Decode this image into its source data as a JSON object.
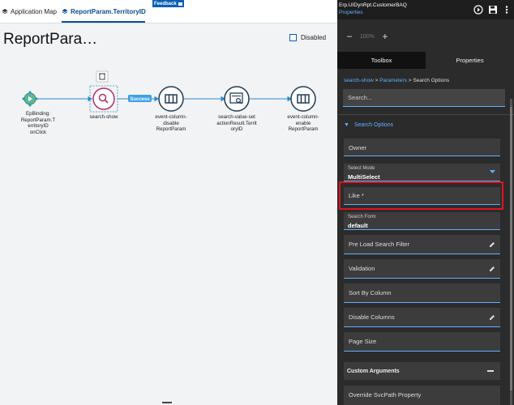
{
  "tabs": [
    {
      "label": "Application Map"
    },
    {
      "label": "ReportParam.TerritoryID"
    }
  ],
  "feedback_label": "Feedback",
  "flow_title": "ReportPara…",
  "disabled_label": "Disabled",
  "nodes": [
    {
      "label_lines": [
        "EpBinding:",
        "ReportParam.T",
        "erritoryID",
        "onClick"
      ]
    },
    {
      "label_lines": [
        "search-show"
      ]
    },
    {
      "label_lines": [
        "event-column-",
        "disable",
        "ReportParam"
      ]
    },
    {
      "label_lines": [
        "search-value-set",
        "actionResult.Territ",
        "oryID"
      ]
    },
    {
      "label_lines": [
        "event-column-",
        "enable",
        "ReportParam"
      ]
    }
  ],
  "edge_label": "Success",
  "right_panel": {
    "title": "Erp.UIDynRpt.CustomerBAQ",
    "subtitle": "Properties",
    "zoom": "100%",
    "tabs": [
      "Toolbox",
      "Properties"
    ],
    "breadcrumb": [
      "search-show",
      "Parameters",
      "Search Options"
    ],
    "search_placeholder": "Search...",
    "section": "Search Options",
    "fields": [
      {
        "label": "Owner"
      },
      {
        "small": "Select Mode",
        "value": "MultiSelect"
      },
      {
        "label": "Like *"
      },
      {
        "small": "Search Form",
        "value": "default"
      },
      {
        "label": "Pre Load Search Filter"
      },
      {
        "label": "Validation"
      },
      {
        "label": "Sort By Column"
      },
      {
        "label": "Disable Columns"
      },
      {
        "label": "Page Size"
      }
    ],
    "custom_args": "Custom Arguments",
    "override": "Override SvcPath Property"
  },
  "colors": {
    "accent": "#5fb0ff",
    "node_border": "#1f3d56",
    "search_node": "#b0306a",
    "success": "#3ca0e6",
    "highlight": "#e0141e"
  }
}
